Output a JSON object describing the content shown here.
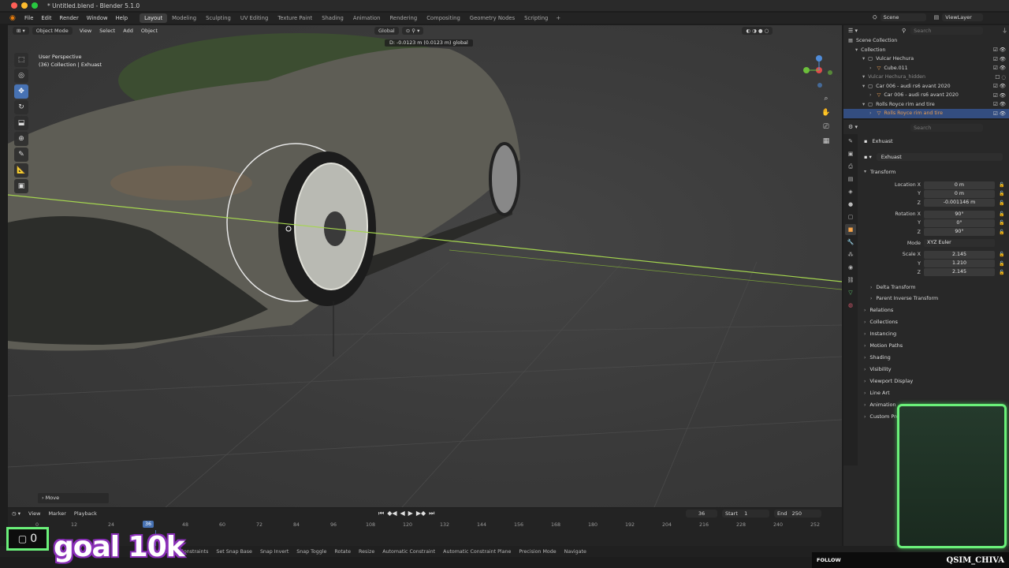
{
  "window": {
    "title": "* Untitled.blend - Blender 5.1.0"
  },
  "menu": [
    "File",
    "Edit",
    "Render",
    "Window",
    "Help"
  ],
  "workspaces": [
    {
      "label": "Layout",
      "active": true
    },
    {
      "label": "Modeling"
    },
    {
      "label": "Sculpting"
    },
    {
      "label": "UV Editing"
    },
    {
      "label": "Texture Paint"
    },
    {
      "label": "Shading"
    },
    {
      "label": "Animation"
    },
    {
      "label": "Rendering"
    },
    {
      "label": "Compositing"
    },
    {
      "label": "Geometry Nodes"
    },
    {
      "label": "Scripting"
    }
  ],
  "workspace_add": "+",
  "scene": {
    "name": "Scene",
    "view_layer": "ViewLayer"
  },
  "viewport": {
    "mode": "Object Mode",
    "menus": [
      "View",
      "Select",
      "Add",
      "Object"
    ],
    "orientation": "Global",
    "info_line1": "User Perspective",
    "info_line2": "(36) Collection | Exhuast",
    "move_readout": "D: -0.0123 m (0.0123 m) global",
    "operator_panel": "Move"
  },
  "timeline": {
    "menus": [
      "View",
      "Marker",
      "Playback"
    ],
    "current_frame": "36",
    "start_label": "Start",
    "start": "1",
    "end_label": "End",
    "end": "250",
    "ticks": [
      "0",
      "12",
      "24",
      "36",
      "48",
      "60",
      "72",
      "84",
      "96",
      "108",
      "120",
      "132",
      "144",
      "156",
      "168",
      "180",
      "192",
      "204",
      "216",
      "228",
      "240",
      "252"
    ]
  },
  "statusbar": [
    "Clear Constraints",
    "Set Snap Base",
    "Snap Invert",
    "Snap Toggle",
    "Rotate",
    "Resize",
    "Automatic Constraint",
    "Automatic Constraint Plane",
    "Precision Mode",
    "Navigate"
  ],
  "outliner": {
    "search_placeholder": "Search",
    "rows": [
      {
        "label": "Scene Collection",
        "indent": 0,
        "style": "normal"
      },
      {
        "label": "Collection",
        "indent": 1,
        "style": "normal"
      },
      {
        "label": "Vulcar Hechura",
        "indent": 2,
        "style": "normal"
      },
      {
        "label": "Cube.011",
        "indent": 3,
        "style": "normal"
      },
      {
        "label": "Vulcar Hechura_hidden",
        "indent": 2,
        "style": "dim"
      },
      {
        "label": "Car 006 - audi rs6 avant 2020",
        "indent": 2,
        "style": "normal"
      },
      {
        "label": "Car 006 - audi rs6 avant 2020",
        "indent": 3,
        "style": "normal"
      },
      {
        "label": "Rolls Royce rim and tire",
        "indent": 2,
        "style": "normal"
      },
      {
        "label": "Rolls Royce rim and tire",
        "indent": 3,
        "style": "selected"
      }
    ]
  },
  "properties": {
    "search_placeholder": "Search",
    "object_name": "Exhuast",
    "object_field": "Exhuast",
    "transform_label": "Transform",
    "location": {
      "label": "Location X",
      "x": "0 m",
      "y": "0 m",
      "z": "-0.001146 m"
    },
    "rotation": {
      "label": "Rotation X",
      "x": "90°",
      "y": "0°",
      "z": "90°"
    },
    "mode_label": "Mode",
    "mode_value": "XYZ Euler",
    "scale": {
      "label": "Scale X",
      "x": "2.145",
      "y": "1.210",
      "z": "2.145"
    },
    "axis_y": "Y",
    "axis_z": "Z",
    "subpanels": [
      "Delta Transform",
      "Parent Inverse Transform"
    ],
    "panels": [
      "Relations",
      "Collections",
      "Instancing",
      "Motion Paths",
      "Shading",
      "Visibility",
      "Viewport Display",
      "Line Art",
      "Animation",
      "Custom Properties"
    ]
  },
  "overlay": {
    "counter": "0",
    "goal": "goal 10k",
    "follow": "FOLLOW",
    "streamer": "QSIM_CHIVA",
    "accent": "#6bf07a"
  }
}
